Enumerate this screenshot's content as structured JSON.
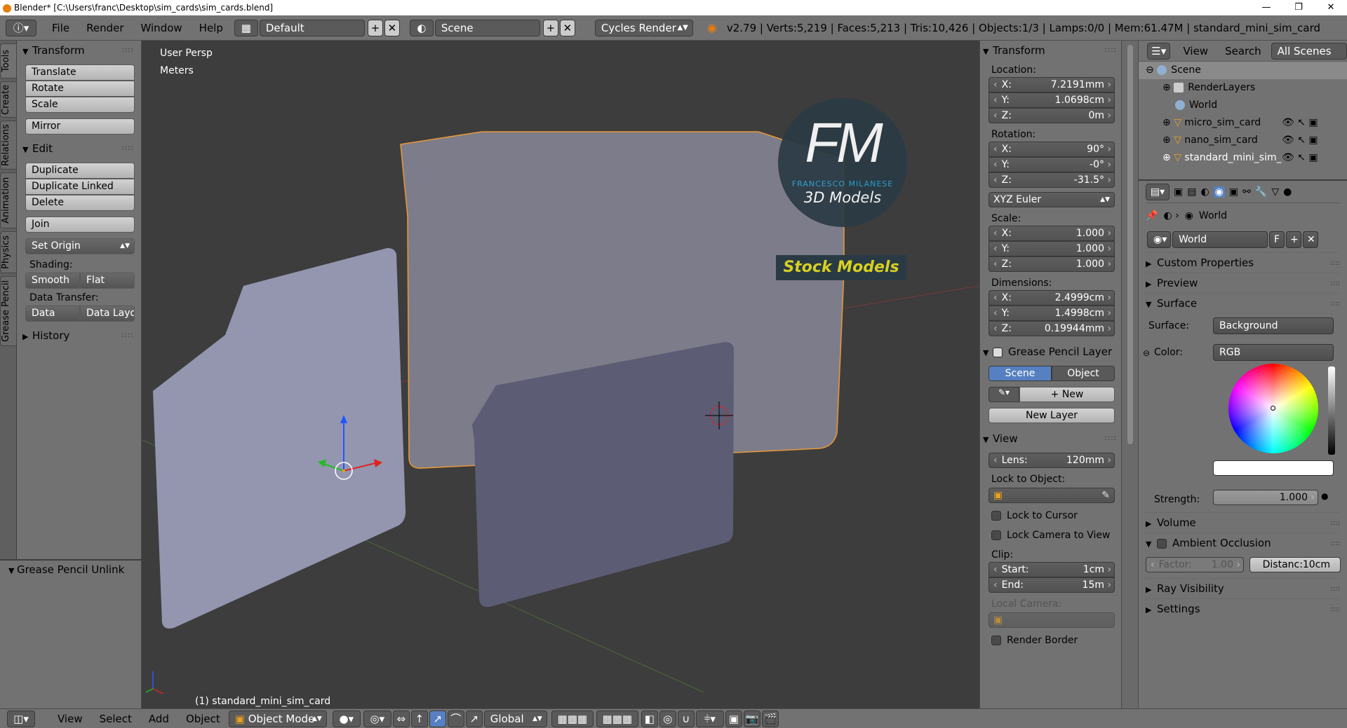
{
  "title_bar": {
    "title": "Blender* [C:\\Users\\franc\\Desktop\\sim_cards\\sim_cards.blend]",
    "minimize": "—",
    "maximize": "❐",
    "close": "✕"
  },
  "info_header": {
    "menus": [
      "File",
      "Render",
      "Window",
      "Help"
    ],
    "screen_layout": "Default",
    "scene": "Scene",
    "render_engine": "Cycles Render",
    "stats": "v2.79 | Verts:5,219 | Faces:5,213 | Tris:10,426 | Objects:1/3 | Lamps:0/0 | Mem:61.47M | standard_mini_sim_card"
  },
  "left_tabs": [
    "Tools",
    "Create",
    "Relations",
    "Animation",
    "Physics",
    "Grease Pencil"
  ],
  "tool_shelf": {
    "transform": {
      "title": "Transform",
      "buttons": [
        "Translate",
        "Rotate",
        "Scale"
      ],
      "mirror": "Mirror"
    },
    "edit": {
      "title": "Edit",
      "buttons": [
        "Duplicate",
        "Duplicate Linked",
        "Delete"
      ],
      "join": "Join",
      "set_origin": "Set Origin"
    },
    "shading": {
      "label": "Shading:",
      "smooth": "Smooth",
      "flat": "Flat"
    },
    "data_transfer": {
      "label": "Data Transfer:",
      "data": "Data",
      "data_layout": "Data Layo"
    },
    "history": "History",
    "grease_pencil_unlinked": "Grease Pencil Unlink"
  },
  "viewport": {
    "view_name": "User Persp",
    "units": "Meters",
    "active_object": "(1) standard_mini_sim_card",
    "watermark": {
      "initials": "FM",
      "author": "FRANCESCO MILANESE",
      "tagline": "3D Models",
      "banner": "Stock Models"
    }
  },
  "n_panel": {
    "transform_title": "Transform",
    "location_label": "Location:",
    "location": [
      {
        "axis": "X:",
        "value": "7.2191mm"
      },
      {
        "axis": "Y:",
        "value": "1.0698cm"
      },
      {
        "axis": "Z:",
        "value": "0m"
      }
    ],
    "rotation_label": "Rotation:",
    "rotation": [
      {
        "axis": "X:",
        "value": "90°"
      },
      {
        "axis": "Y:",
        "value": "-0°"
      },
      {
        "axis": "Z:",
        "value": "-31.5°"
      }
    ],
    "rotation_mode": "XYZ Euler",
    "scale_label": "Scale:",
    "scale": [
      {
        "axis": "X:",
        "value": "1.000"
      },
      {
        "axis": "Y:",
        "value": "1.000"
      },
      {
        "axis": "Z:",
        "value": "1.000"
      }
    ],
    "dimensions_label": "Dimensions:",
    "dimensions": [
      {
        "axis": "X:",
        "value": "2.4999cm"
      },
      {
        "axis": "Y:",
        "value": "1.4998cm"
      },
      {
        "axis": "Z:",
        "value": "0.19944mm"
      }
    ],
    "grease_pencil_title": "Grease Pencil Layer",
    "gp_scene": "Scene",
    "gp_object": "Object",
    "gp_new": "New",
    "gp_new_layer": "New Layer",
    "view_title": "View",
    "lens_label": "Lens:",
    "lens_value": "120mm",
    "lock_to_object_label": "Lock to Object:",
    "lock_to_cursor": "Lock to Cursor",
    "lock_camera_to_view": "Lock Camera to View",
    "clip_label": "Clip:",
    "clip_start_label": "Start:",
    "clip_start": "1cm",
    "clip_end_label": "End:",
    "clip_end": "15m",
    "local_camera_label": "Local Camera:",
    "render_border": "Render Border"
  },
  "outliner": {
    "menus": [
      "View",
      "Search"
    ],
    "display_mode": "All Scenes",
    "rows": [
      "Scene",
      "RenderLayers",
      "World",
      "micro_sim_card",
      "nano_sim_card",
      "standard_mini_sim_"
    ]
  },
  "properties": {
    "breadcrumb": "World",
    "world_name": "World",
    "fake_user": "F",
    "sections": {
      "custom_properties": "Custom Properties",
      "preview": "Preview",
      "surface": "Surface",
      "volume": "Volume",
      "ambient_occlusion": "Ambient Occlusion",
      "ray_visibility": "Ray Visibility",
      "settings": "Settings"
    },
    "surface_label": "Surface:",
    "surface_value": "Background",
    "color_label": "Color:",
    "color_mode": "RGB",
    "strength_label": "Strength:",
    "strength_value": "1.000",
    "ao_factor_label": "Factor:",
    "ao_factor": "1.00",
    "ao_distance_label": "Distanc:",
    "ao_distance": "10cm"
  },
  "bottom_bar": {
    "menus": [
      "View",
      "Select",
      "Add",
      "Object"
    ],
    "mode": "Object Mode",
    "orientation": "Global"
  }
}
